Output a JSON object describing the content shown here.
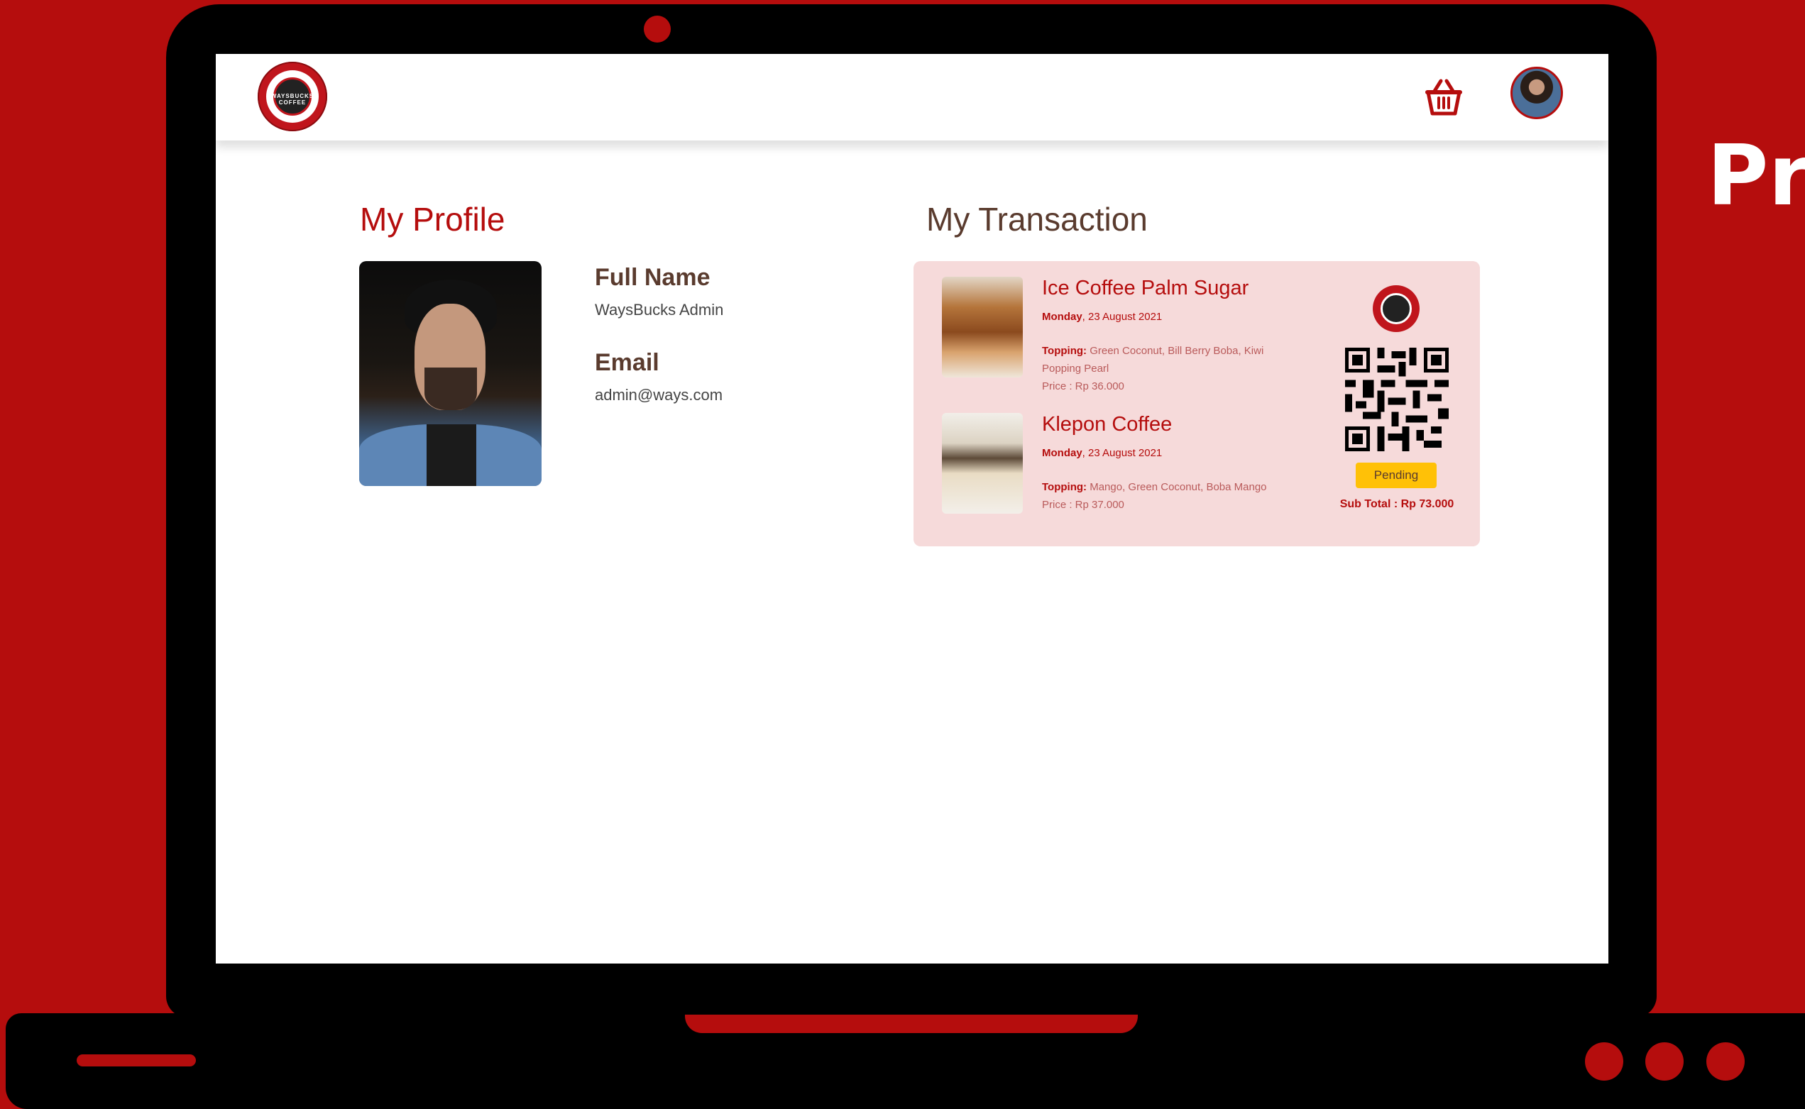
{
  "side_title": "Pr",
  "navbar": {
    "logo_text": "WAYSBUCKS COFFEE",
    "cart_icon": "cart-icon",
    "avatar_icon": "avatar"
  },
  "profile": {
    "heading": "My Profile",
    "full_name_label": "Full Name",
    "full_name_value": "WaysBucks Admin",
    "email_label": "Email",
    "email_value": "admin@ways.com"
  },
  "transaction": {
    "heading": "My Transaction",
    "items": [
      {
        "title": "Ice Coffee Palm Sugar",
        "day": "Monday",
        "date": ", 23 August 2021",
        "topping_label": "Topping:",
        "topping_value": " Green Coconut, Bill Berry Boba, Kiwi Popping Pearl",
        "price": "Price : Rp 36.000"
      },
      {
        "title": "Klepon Coffee",
        "day": "Monday",
        "date": ", 23 August 2021",
        "topping_label": "Topping:",
        "topping_value": " Mango, Green Coconut, Boba Mango",
        "price": "Price : Rp 37.000"
      }
    ],
    "status": "Pending",
    "subtotal": "Sub Total : Rp 73.000"
  },
  "colors": {
    "brand_red": "#b50d0d",
    "card_bg": "#f6dada",
    "pending": "#ffc107",
    "heading_brown": "#5a3b2e"
  }
}
